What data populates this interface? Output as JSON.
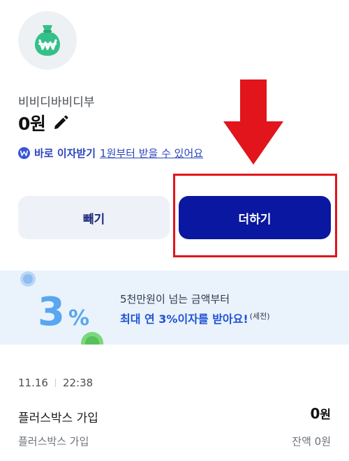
{
  "account": {
    "name": "비비디바비디부",
    "balance": "0원"
  },
  "interest": {
    "label": "바로 이자받기",
    "link": "1원부터 받을 수 있어요"
  },
  "actions": {
    "withdraw_label": "빼기",
    "deposit_label": "더하기"
  },
  "banner": {
    "percent": "3",
    "percent_sign": "%",
    "line1": "5천만원이 넘는 금액부터",
    "line2": "최대 연 3%이자를 받아요!",
    "note": "(세전)"
  },
  "transactions": [
    {
      "date": "11.16",
      "time": "22:38",
      "title": "플러스박스 가입",
      "subtitle": "플러스박스 가입",
      "amount": "0",
      "amount_unit": "원",
      "balance": "잔액 0원"
    }
  ],
  "colors": {
    "primary": "#0a17a0",
    "accent_blue": "#1f52d6",
    "logo_green": "#35c08a",
    "annotation_red": "#e2141c",
    "banner_bg": "#eaf3fc"
  },
  "icons": {
    "logo": "money-bag-icon",
    "edit": "pencil-icon",
    "interest": "won-badge-icon",
    "annotation": "red-arrow-icon"
  }
}
